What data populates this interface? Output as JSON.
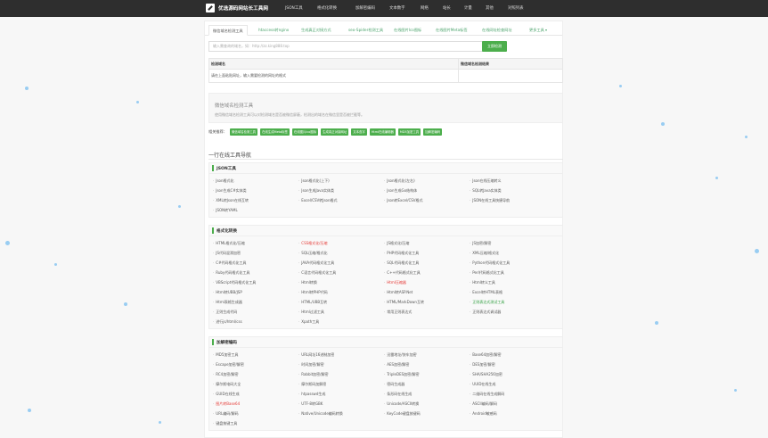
{
  "header": {
    "logo_text": "优选源码网站长工具网",
    "nav": [
      {
        "label": "JSON工具",
        "caret": true
      },
      {
        "label": "格式化转换",
        "caret": true
      },
      {
        "label": "加解密编码",
        "caret": true
      },
      {
        "label": "文本数字",
        "caret": true
      },
      {
        "label": "网络",
        "caret": true
      },
      {
        "label": "站长",
        "caret": true
      },
      {
        "label": "计量",
        "caret": true
      },
      {
        "label": "其他",
        "caret": true
      },
      {
        "label": "对照列表",
        "caret": true
      }
    ]
  },
  "tabs": [
    {
      "label": "微信域名检测工具",
      "active": true
    },
    {
      "label": "htaccess转nginx",
      "active": false
    },
    {
      "label": "生成真正对接方式",
      "active": false
    },
    {
      "label": "seo-Spider检测工具",
      "active": false
    },
    {
      "label": "在线图片Ico图标",
      "active": false
    },
    {
      "label": "在线图片Meta标签",
      "active": false
    },
    {
      "label": "在线网址检查网址",
      "active": false
    },
    {
      "label": "更多工具",
      "active": false,
      "caret": true
    }
  ],
  "search": {
    "placeholder": "输入需查询的域名，如：http://zz.king888.top",
    "button": "立即检测"
  },
  "result_table": {
    "col1": "检测域名",
    "col2": "微信域名检测结果",
    "row_text": "请在上面粘贴网址，输入需要检测的网址的格式"
  },
  "tool_info": {
    "title": "微信域名检测工具",
    "desc": "使用微信域名检测工具可以对检测域名是否被微信屏蔽，检测出的域名在微信里是否被拦截等。"
  },
  "recommend": {
    "label": "相关推荐：",
    "tags": [
      "微信域名检测工具",
      "在线生成Meta标签",
      "在线图片Ico图标",
      "生成真正对接网址",
      "文本查字",
      "Html在线编辑器",
      "MD5加密工具",
      "加解密编码"
    ]
  },
  "section_title": "一行在线工具导航",
  "categories": [
    {
      "name": "JSON工具",
      "items": [
        {
          "label": "Json格式化"
        },
        {
          "label": "Json格式化(上下)"
        },
        {
          "label": "Json格式化(左右)"
        },
        {
          "label": "Json在线压缩转义"
        },
        {
          "label": "Json生成C#实体类"
        },
        {
          "label": "Json生成Java实体类"
        },
        {
          "label": "Json生成Go结构体"
        },
        {
          "label": "SQL转Java实体类"
        },
        {
          "label": "XML转Json在线互转"
        },
        {
          "label": "Excel/CSV转Json格式"
        },
        {
          "label": "Json转Excel/CSV格式"
        },
        {
          "label": "JSON在线工具快捷导航"
        },
        {
          "label": "JSON转YAML"
        }
      ]
    },
    {
      "name": "格式化转换",
      "items": [
        {
          "label": "HTML格式化/压缩"
        },
        {
          "label": "CSS格式化/压缩",
          "style": "red"
        },
        {
          "label": "JS格式化/压缩"
        },
        {
          "label": "JS加密/解密"
        },
        {
          "label": "JS代码混淆加密"
        },
        {
          "label": "SQL压缩/格式化"
        },
        {
          "label": "PHP代码格式化工具"
        },
        {
          "label": "XML压缩/格式化"
        },
        {
          "label": "C#代码格式化工具"
        },
        {
          "label": "JAVA代码格式化工具"
        },
        {
          "label": "SQL代码格式化工具"
        },
        {
          "label": "Python代码格式化工具"
        },
        {
          "label": "Ruby代码格式化工具"
        },
        {
          "label": "C语言代码格式化工具"
        },
        {
          "label": "C++代码格式化工具"
        },
        {
          "label": "Perl代码格式化工具"
        },
        {
          "label": "VBScript代码格式化工具"
        },
        {
          "label": "Html转换"
        },
        {
          "label": "Html压缩器",
          "style": "red"
        },
        {
          "label": "Html转义工具"
        },
        {
          "label": "Html转UBB/JSP"
        },
        {
          "label": "Html转PHP代码"
        },
        {
          "label": "Html转ASP.Net"
        },
        {
          "label": "Excel转HTML表格"
        },
        {
          "label": "Html表格生成器"
        },
        {
          "label": "HTML/UBB互转"
        },
        {
          "label": "HTML/MarkDown互转"
        },
        {
          "label": "正则表达式测试工具",
          "style": "green"
        },
        {
          "label": "正则生成代码"
        },
        {
          "label": "Html过滤工具"
        },
        {
          "label": "常用正则表达式"
        },
        {
          "label": "正则表达式调试器"
        },
        {
          "label": "进行js/html/css"
        },
        {
          "label": "Xpath工具"
        }
      ]
    },
    {
      "name": "加解密编码",
      "items": [
        {
          "label": "MD5加密工具"
        },
        {
          "label": "URL网址16进制加密"
        },
        {
          "label": "迅雷地址/快车加密"
        },
        {
          "label": "Base64加密/解密"
        },
        {
          "label": "Escape加密/解密"
        },
        {
          "label": "时间加密/解密"
        },
        {
          "label": "AES加密/解密"
        },
        {
          "label": "DES加密/解密"
        },
        {
          "label": "RC4加密/解密"
        },
        {
          "label": "Rabbit加密/解密"
        },
        {
          "label": "TripleDES加密/解密"
        },
        {
          "label": "SHA/SHA256加密"
        },
        {
          "label": "摩尔斯电码大全"
        },
        {
          "label": "摩尔斯码加解密"
        },
        {
          "label": "密码生成器"
        },
        {
          "label": "UUID在线生成"
        },
        {
          "label": "GUID在线生成"
        },
        {
          "label": "htpasswd生成"
        },
        {
          "label": "条形码在线生成"
        },
        {
          "label": "二维码在线生成解码"
        },
        {
          "label": "图片转Base64",
          "style": "red"
        },
        {
          "label": "UTF-8转GBK"
        },
        {
          "label": "Unicode/ASCII转换"
        },
        {
          "label": "ASCII编码/解码"
        },
        {
          "label": "URL编码/解码"
        },
        {
          "label": "Native/Unicode编码转换"
        },
        {
          "label": "KeyCode键盘按键码"
        },
        {
          "label": "Android敏感码"
        },
        {
          "label": "键盘按键工具"
        }
      ]
    }
  ]
}
